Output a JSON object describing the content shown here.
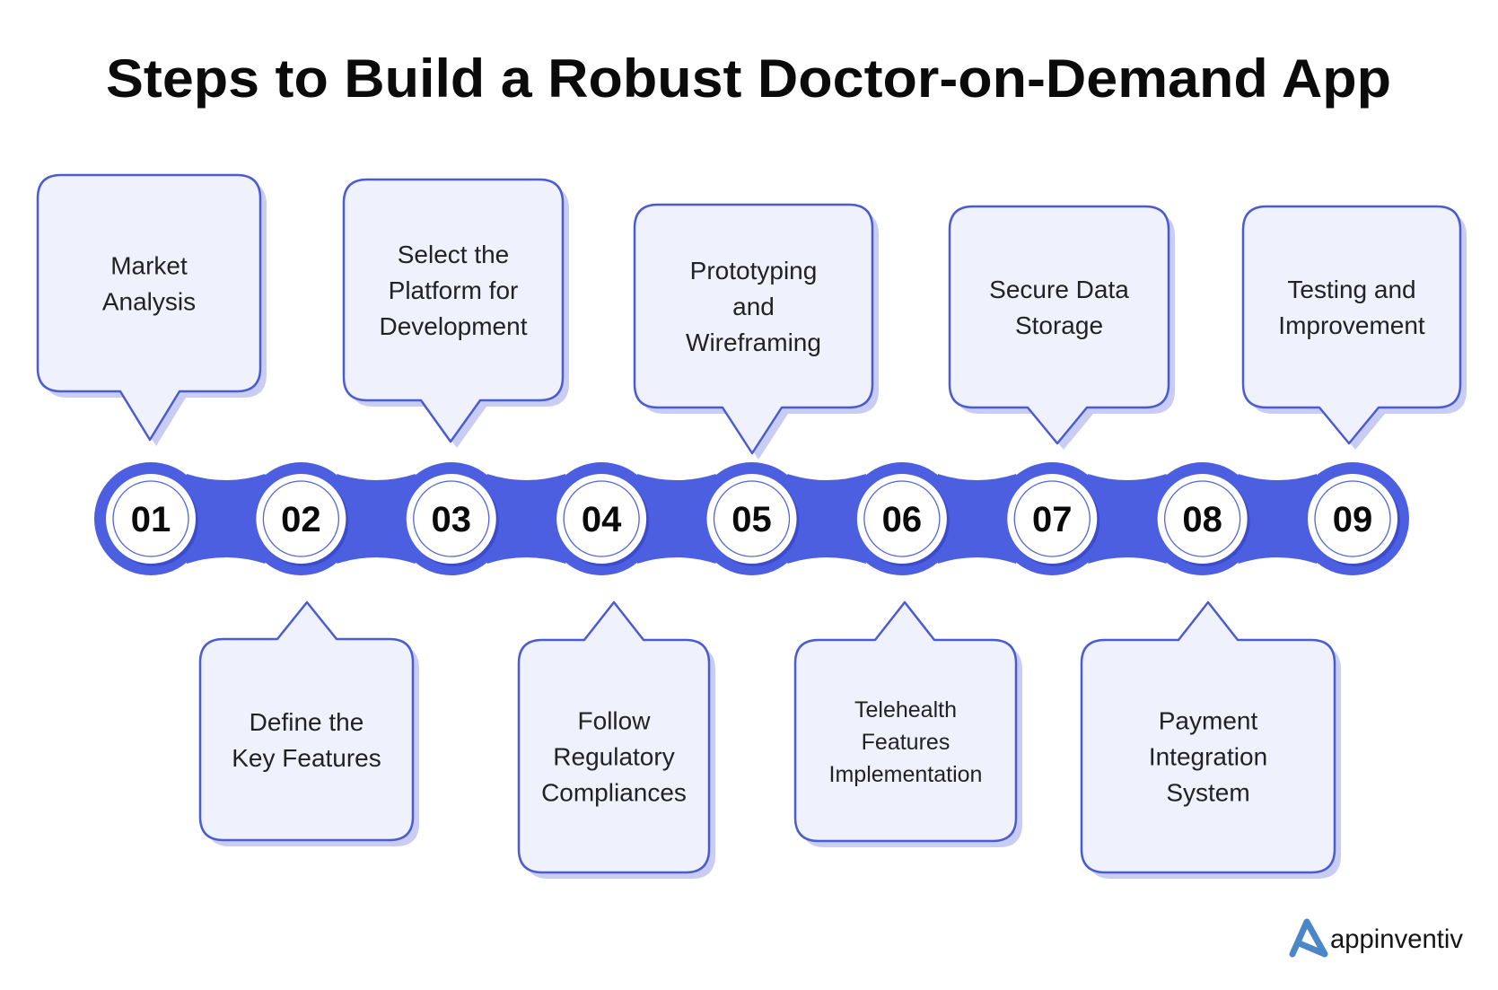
{
  "title": "Steps to Build a Robust Doctor-on-Demand App",
  "colors": {
    "chain_blue": "#4c5fe0",
    "bubble_fill": "#eff1fd",
    "bubble_border": "#4b5bd1",
    "bubble_shadow": "#c9cdf3",
    "logo_blue": "#4a86c8",
    "text_dark": "#222222"
  },
  "steps": [
    {
      "number": "01",
      "lines": [
        "Market",
        "Analysis"
      ],
      "position": "above"
    },
    {
      "number": "02",
      "lines": [
        "Define the",
        "Key Features"
      ],
      "position": "below"
    },
    {
      "number": "03",
      "lines": [
        "Select the",
        "Platform for",
        "Development"
      ],
      "position": "above"
    },
    {
      "number": "04",
      "lines": [
        "Follow",
        "Regulatory",
        "Compliances"
      ],
      "position": "below"
    },
    {
      "number": "05",
      "lines": [
        "Prototyping",
        "and",
        "Wireframing"
      ],
      "position": "above"
    },
    {
      "number": "06",
      "lines": [
        "Telehealth",
        "Features",
        "Implementation"
      ],
      "position": "below"
    },
    {
      "number": "07",
      "lines": [
        "Secure Data",
        "Storage"
      ],
      "position": "above"
    },
    {
      "number": "08",
      "lines": [
        "Payment",
        "Integration",
        "System"
      ],
      "position": "below"
    },
    {
      "number": "09",
      "lines": [
        "Testing and",
        "Improvement"
      ],
      "position": "above"
    }
  ],
  "logo": {
    "icon": "appinventiv-a-logo-icon",
    "text": "appinventiv"
  }
}
